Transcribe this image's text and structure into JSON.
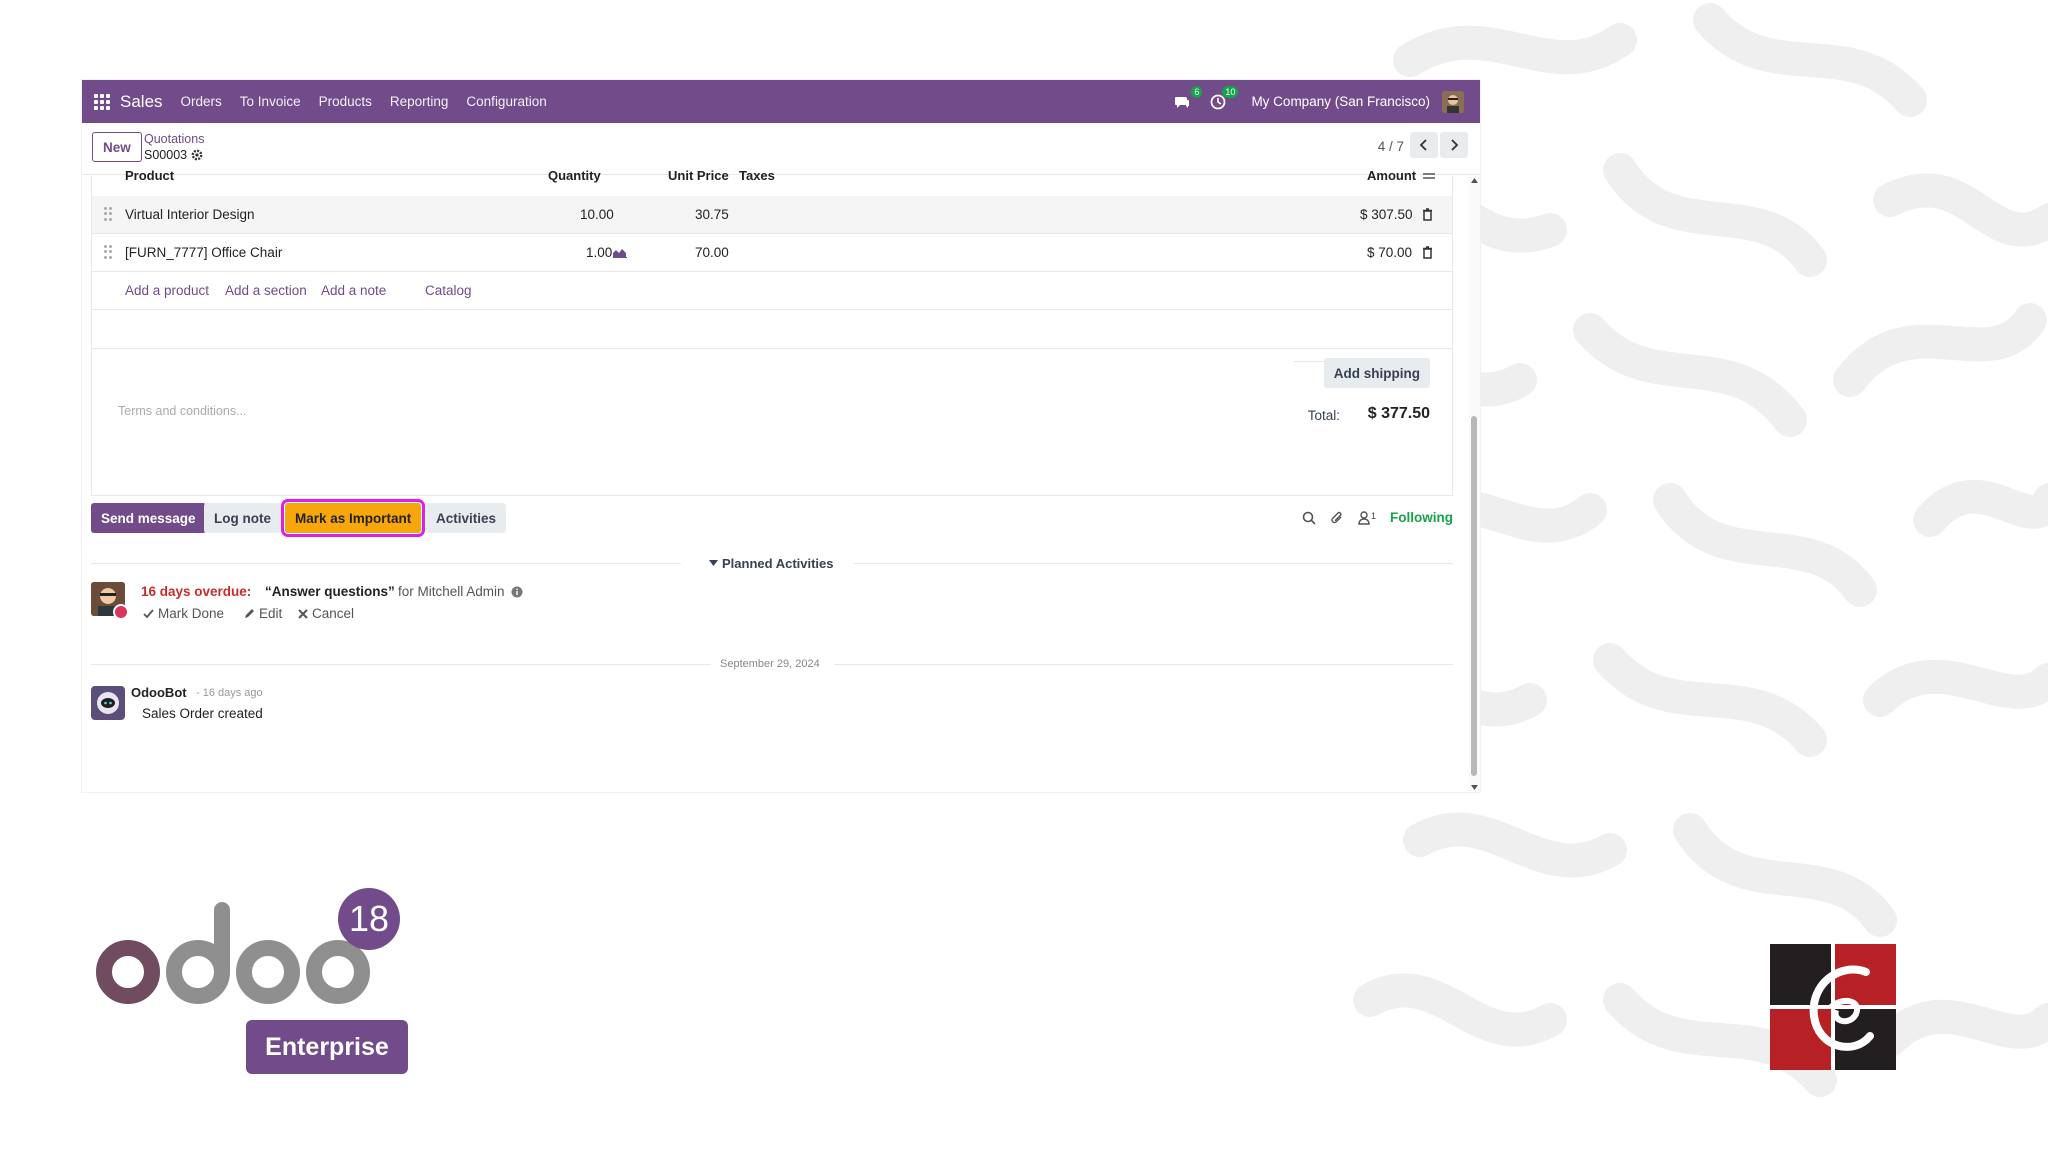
{
  "topbar": {
    "app_name": "Sales",
    "menu": [
      "Orders",
      "To Invoice",
      "Products",
      "Reporting",
      "Configuration"
    ],
    "messages_count": "6",
    "activities_count": "10",
    "company": "My Company (San Francisco)"
  },
  "control": {
    "new_label": "New",
    "breadcrumb_parent": "Quotations",
    "record_name": "S00003",
    "pager": "4 / 7"
  },
  "order_lines": {
    "headers": {
      "product": "Product",
      "quantity": "Quantity",
      "unit_price": "Unit Price",
      "taxes": "Taxes",
      "amount": "Amount"
    },
    "rows": [
      {
        "product": "Virtual Interior Design",
        "quantity": "10.00",
        "unit_price": "30.75",
        "amount": "$ 307.50"
      },
      {
        "product": "[FURN_7777] Office Chair",
        "quantity": "1.00",
        "unit_price": "70.00",
        "amount": "$ 70.00"
      }
    ],
    "actions": [
      "Add a product",
      "Add a section",
      "Add a note",
      "Catalog"
    ]
  },
  "footer": {
    "terms_placeholder": "Terms and conditions...",
    "add_shipping": "Add shipping",
    "total_label": "Total:",
    "total_value": "$ 377.50"
  },
  "chatter": {
    "buttons": {
      "send_message": "Send message",
      "log_note": "Log note",
      "mark_important": "Mark as Important",
      "activities": "Activities"
    },
    "followers_count": "1",
    "following_label": "Following",
    "planned_label": "Planned Activities",
    "activity": {
      "overdue": "16 days overdue:",
      "title": "“Answer questions”",
      "for": "for Mitchell Admin",
      "mark_done": "Mark Done",
      "edit": "Edit",
      "cancel": "Cancel"
    },
    "date_separator": "September 29, 2024",
    "message": {
      "author": "OdooBot",
      "time": "- 16 days ago",
      "body": "Sales Order created"
    }
  },
  "branding": {
    "wordmark": "odoo",
    "version": "18",
    "edition": "Enterprise"
  },
  "colors": {
    "brand": "#714b8a",
    "important": "#f7a70c",
    "highlight": "#e11ee6",
    "overdue": "#c72d2d",
    "following": "#17a34a",
    "partner_red": "#b72025",
    "partner_dark": "#231f20"
  }
}
